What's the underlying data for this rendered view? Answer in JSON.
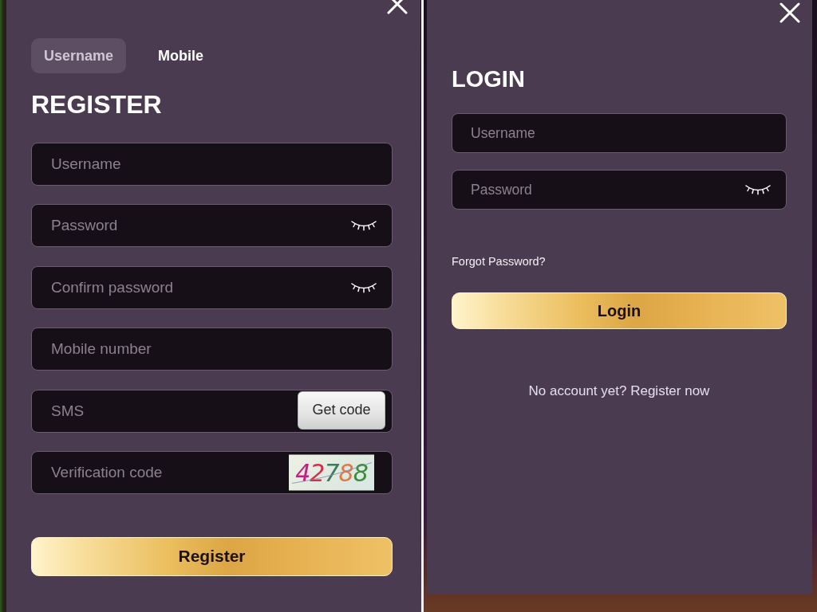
{
  "register": {
    "tabs": [
      {
        "label": "Username",
        "selected": true
      },
      {
        "label": "Mobile",
        "selected": false
      }
    ],
    "title": "REGISTER",
    "fields": [
      {
        "kind": "text",
        "placeholder": "Username"
      },
      {
        "kind": "password",
        "placeholder": "Password"
      },
      {
        "kind": "password",
        "placeholder": "Confirm password"
      },
      {
        "kind": "text",
        "placeholder": "Mobile number"
      },
      {
        "kind": "sms",
        "placeholder": "SMS",
        "button": "Get code"
      },
      {
        "kind": "captcha",
        "placeholder": "Verification code",
        "captcha": "42788"
      }
    ],
    "submit": "Register"
  },
  "login": {
    "title": "LOGIN",
    "fields": [
      {
        "kind": "text",
        "placeholder": "Username"
      },
      {
        "kind": "password",
        "placeholder": "Password"
      }
    ],
    "forgot": "Forgot Password?",
    "submit": "Login",
    "prompt": "No account yet?",
    "prompt_link": "Register now"
  }
}
